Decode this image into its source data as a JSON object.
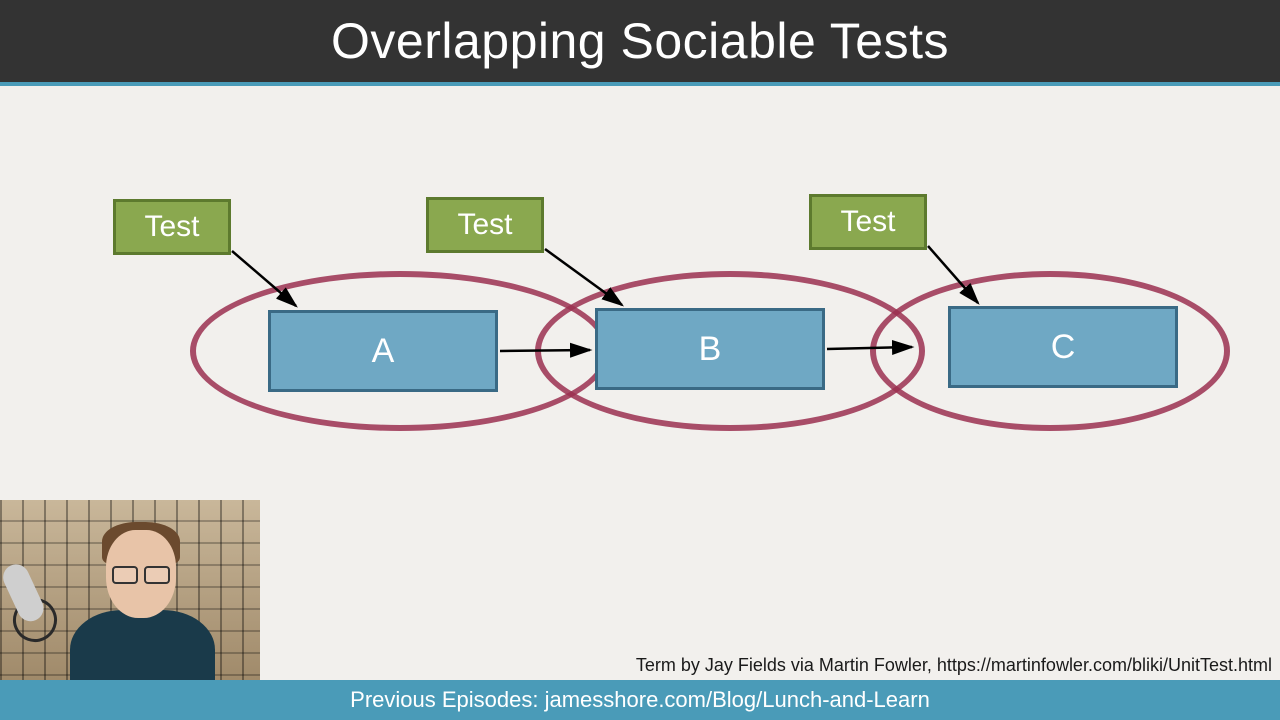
{
  "header": {
    "title": "Overlapping Sociable Tests"
  },
  "tests": [
    {
      "label": "Test"
    },
    {
      "label": "Test"
    },
    {
      "label": "Test"
    }
  ],
  "modules": [
    {
      "label": "A"
    },
    {
      "label": "B"
    },
    {
      "label": "C"
    }
  ],
  "attribution": "Term by Jay Fields via Martin Fowler, https://martinfowler.com/bliki/UnitTest.html",
  "footer": {
    "text": "Previous Episodes: jamesshore.com/Blog/Lunch-and-Learn"
  },
  "colors": {
    "header_bg": "#333333",
    "accent": "#4a9bb8",
    "test_fill": "#8aa84f",
    "test_border": "#5d7a2e",
    "module_fill": "#6fa8c4",
    "module_border": "#3a6a85",
    "ellipse": "#9b3050"
  }
}
